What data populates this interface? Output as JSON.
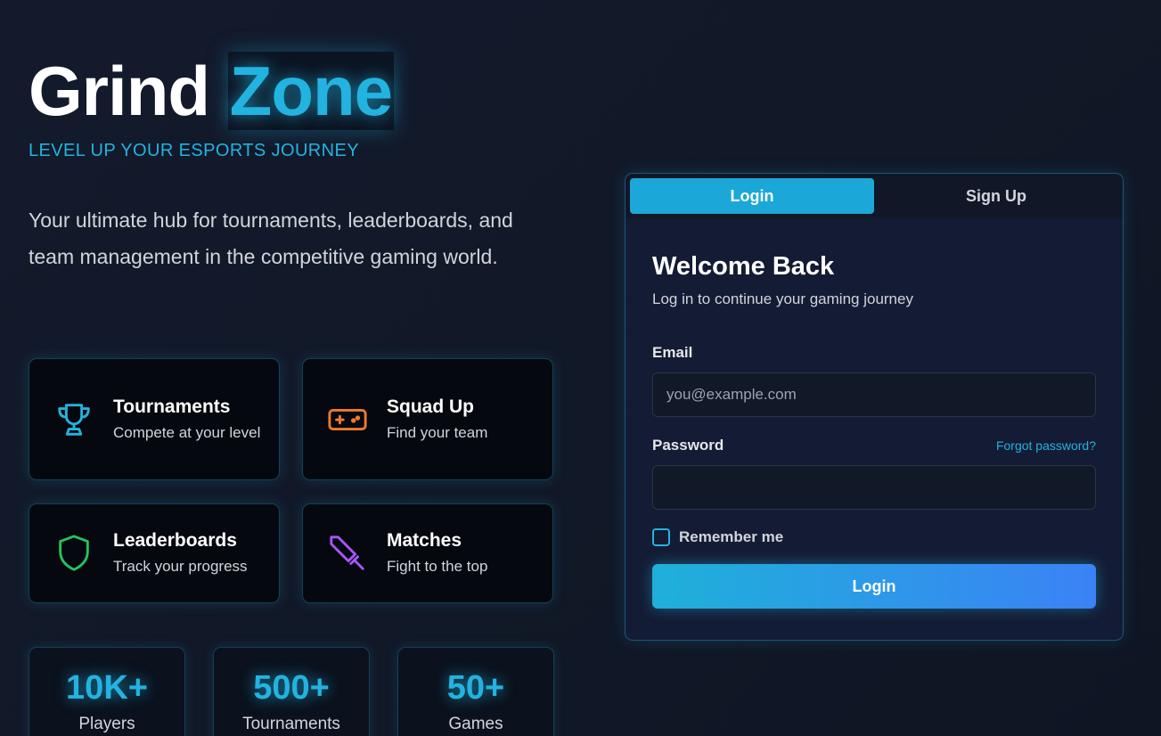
{
  "brand": {
    "part1": "Grind",
    "part2": "Zone"
  },
  "tagline": "LEVEL UP YOUR ESPORTS JOURNEY",
  "intro": "Your ultimate hub for tournaments, leaderboards, and team management in the competitive gaming world.",
  "features": [
    {
      "title": "Tournaments",
      "subtitle": "Compete at your level",
      "icon": "trophy-icon",
      "color": "#22b3e0"
    },
    {
      "title": "Squad Up",
      "subtitle": "Find your team",
      "icon": "gamepad-icon",
      "color": "#f07a2a"
    },
    {
      "title": "Leaderboards",
      "subtitle": "Track your progress",
      "icon": "shield-icon",
      "color": "#22c55e"
    },
    {
      "title": "Matches",
      "subtitle": "Fight to the top",
      "icon": "sword-icon",
      "color": "#a855f7"
    }
  ],
  "stats": [
    {
      "value": "10K+",
      "label": "Players"
    },
    {
      "value": "500+",
      "label": "Tournaments"
    },
    {
      "value": "50+",
      "label": "Games"
    }
  ],
  "auth": {
    "tabs": {
      "login": "Login",
      "signup": "Sign Up"
    },
    "title": "Welcome Back",
    "subtitle": "Log in to continue your gaming journey",
    "email_label": "Email",
    "email_placeholder": "you@example.com",
    "password_label": "Password",
    "forgot_label": "Forgot password?",
    "remember_label": "Remember me",
    "submit_label": "Login"
  },
  "colors": {
    "accent": "#22b3e0",
    "background": "#111827",
    "card": "#141b34"
  }
}
